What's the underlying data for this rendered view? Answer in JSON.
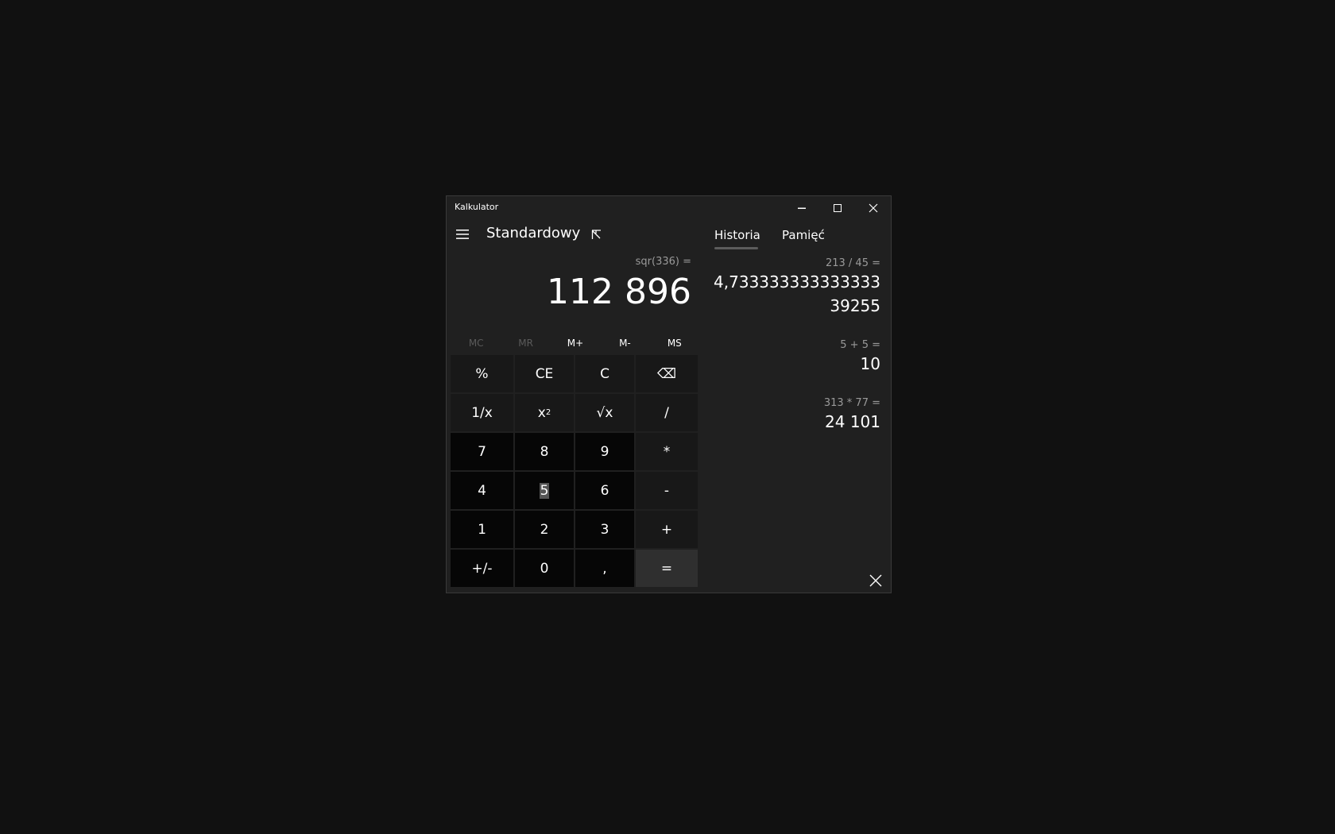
{
  "window": {
    "title": "Kalkulator"
  },
  "header": {
    "mode": "Standardowy"
  },
  "display": {
    "expression": "sqr(336) =",
    "value": "112 896"
  },
  "memory": {
    "buttons": [
      "MC",
      "MR",
      "M+",
      "M-",
      "MS"
    ],
    "disabled": [
      true,
      true,
      false,
      false,
      false
    ]
  },
  "keys": {
    "percent": "%",
    "ce": "CE",
    "c": "C",
    "backspace": "⌫",
    "reciprocal": "1/x",
    "square_base": "x",
    "square_exp": "2",
    "sqrt": "√x",
    "divide": "/",
    "seven": "7",
    "eight": "8",
    "nine": "9",
    "multiply": "*",
    "four": "4",
    "five": "5",
    "six": "6",
    "minus": "-",
    "one": "1",
    "two": "2",
    "three": "3",
    "plus": "+",
    "negate": "+/-",
    "zero": "0",
    "decimal": ",",
    "equals": "="
  },
  "side_panel": {
    "tabs": [
      "Historia",
      "Pamięć"
    ],
    "active_tab": "Historia",
    "history": [
      {
        "expression": "213 / 45 =",
        "result": "4,73333333333333339255"
      },
      {
        "expression": "5 + 5 =",
        "result": "10"
      },
      {
        "expression": "313 * 77 =",
        "result": "24 101"
      }
    ]
  },
  "colors": {
    "background": "#111111",
    "window": "#202020",
    "number_key": "#060606",
    "function_key": "#131313",
    "equals_key": "#2f2f2f"
  },
  "icons": [
    "hamburger-icon",
    "keep-on-top-icon",
    "minimize-icon",
    "maximize-icon",
    "close-icon",
    "backspace-icon",
    "delete-history-icon"
  ]
}
